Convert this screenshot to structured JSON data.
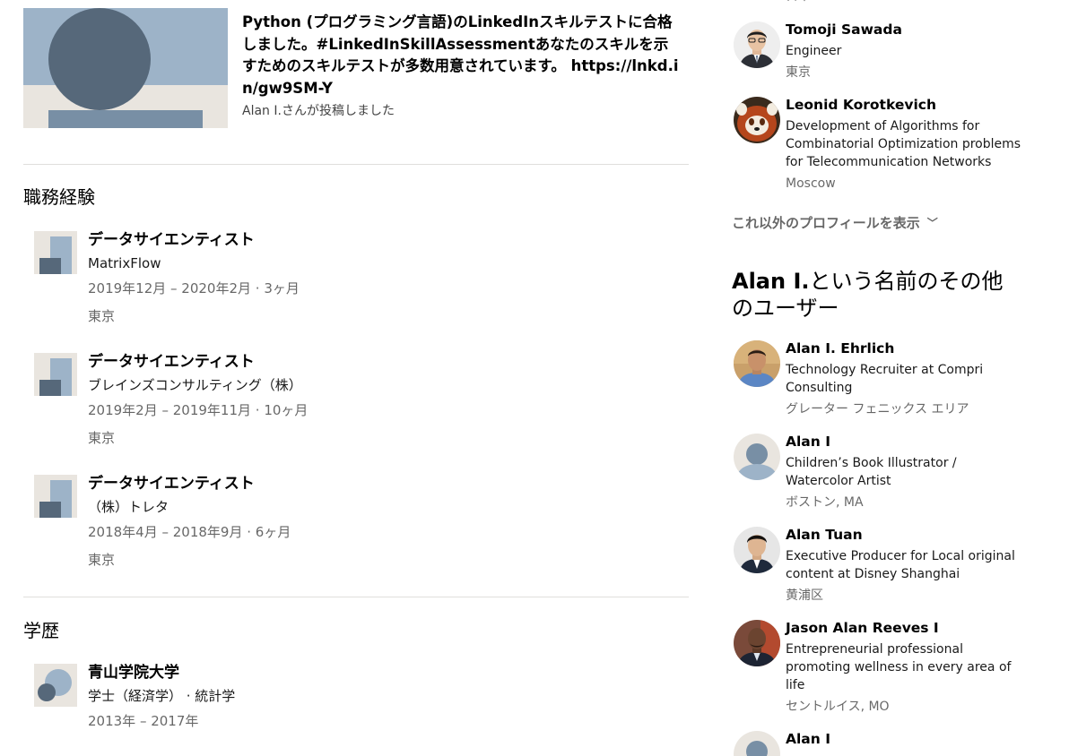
{
  "post": {
    "title": "Python (プログラミング言語)のLinkedInスキルテストに合格しました。#LinkedInSkillAssessmentあなたのスキルを示すためのスキルテストが多数用意されています。 https://lnkd.in/gw9SM-Y",
    "author": "Alan I.さんが投稿しました"
  },
  "experience": {
    "title": "職務経験",
    "items": [
      {
        "role": "データサイエンティスト",
        "company": "MatrixFlow",
        "dates": "2019年12月 – 2020年2月 · 3ヶ月",
        "location": "東京"
      },
      {
        "role": "データサイエンティスト",
        "company": "ブレインズコンサルティング（株）",
        "dates": "2019年2月 – 2019年11月 · 10ヶ月",
        "location": "東京"
      },
      {
        "role": "データサイエンティスト",
        "company": "（株）トレタ",
        "dates": "2018年4月 – 2018年9月 · 6ヶ月",
        "location": "東京"
      }
    ]
  },
  "education": {
    "title": "学歴",
    "items": [
      {
        "school": "青山学院大学",
        "degree": "学士（経済学） · 統計学",
        "dates": "2013年 – 2017年"
      }
    ]
  },
  "rail": {
    "cut_off_location": "日本",
    "also_viewed": [
      {
        "name": "Tomoji Sawada",
        "headline": "Engineer",
        "location": "東京",
        "avatar": "photo-person-glasses"
      },
      {
        "name": "Leonid Korotkevich",
        "headline": "Development of Algorithms for Combinatorial Optimization problems for Telecommunication Networks",
        "location": "Moscow",
        "avatar": "photo-red-panda"
      }
    ],
    "show_more_label": "これ以外のプロフィールを表示",
    "others_heading_name": "Alan I.",
    "others_heading_rest": "という名前のその他のユーザー",
    "others": [
      {
        "name": "Alan I. Ehrlich",
        "headline": "Technology Recruiter at Compri Consulting",
        "location": "グレーター フェニックス エリア",
        "avatar": "photo"
      },
      {
        "name": "Alan I",
        "headline": "Children’s Book Illustrator / Watercolor Artist",
        "location": "ボストン, MA",
        "avatar": "placeholder"
      },
      {
        "name": "Alan Tuan",
        "headline": "Executive Producer for Local original content at Disney Shanghai",
        "location": "黄浦区",
        "avatar": "photo"
      },
      {
        "name": "Jason Alan Reeves I",
        "headline": "Entrepreneurial professional promoting wellness in every area of life",
        "location": "セントルイス, MO",
        "avatar": "photo"
      },
      {
        "name": "Alan I",
        "headline": "",
        "location": "",
        "avatar": "placeholder"
      }
    ]
  },
  "colors": {
    "ghost_light": "#9db3c8",
    "ghost_dark": "#56687a",
    "ghost_bg": "#e9e5df",
    "divider": "#e0dfdc"
  }
}
